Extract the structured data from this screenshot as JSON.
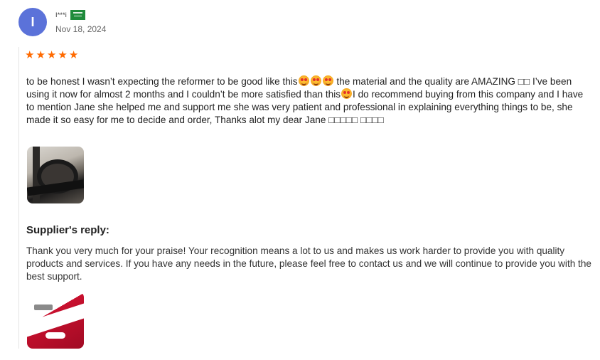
{
  "reviewer": {
    "avatar_letter": "I",
    "name": "I***i",
    "country": "Saudi Arabia",
    "date": "Nov 18, 2024",
    "avatar_color": "#5b72d9"
  },
  "rating": {
    "stars": 5,
    "max": 5,
    "star_color": "#ff6a00"
  },
  "review": {
    "text_part1": "to be honest I wasn’t expecting the reformer to be good like this",
    "text_part2": " the material and the quality are AMAZING □□ I’ve been using it now for almost 2 months and I couldn’t be more satisfied than this",
    "text_part3": "I do recommend buying from this company and I have to mention Jane she helped me and support me she was very patient and professional in explaining everything things to be, she made it so easy for me to decide and order, Thanks alot my dear Jane □□□□□ □□□□",
    "emoji_icon": "star-struck-emoji-icon",
    "photo_icon": "reformer-photo"
  },
  "supplier_reply": {
    "title": "Supplier's reply:",
    "text": "Thank you very much for your praise! Your recognition means a lot to us and makes us work harder to provide you with quality products and services. If you have any needs in the future, please feel free to contact us and we will continue to provide you with the best support.",
    "photo_icon": "supplier-promo-photo"
  }
}
